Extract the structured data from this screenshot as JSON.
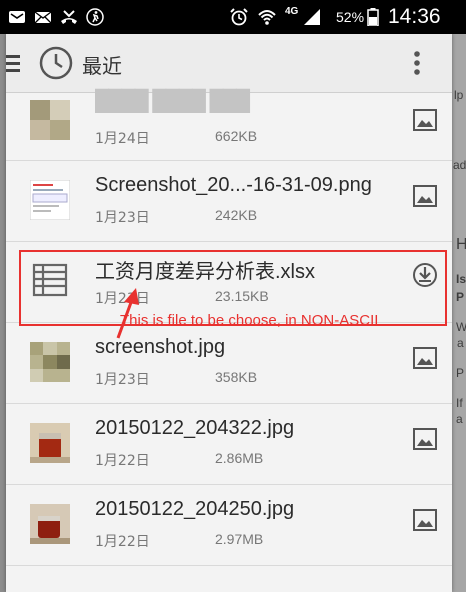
{
  "status_bar": {
    "network": "4G",
    "battery_percent": "52%",
    "time": "14:36"
  },
  "dialog": {
    "title": "最近",
    "icons": {
      "left": "clock-icon",
      "menu": "overflow-menu-icon"
    },
    "files": [
      {
        "name": "",
        "date": "1月24日",
        "size": "662KB",
        "thumb": "blurred-image",
        "action": "image-icon"
      },
      {
        "name": "Screenshot_20...-16-31-09.png",
        "date": "1月23日",
        "size": "242KB",
        "thumb": "screenshot",
        "action": "image-icon"
      },
      {
        "name": "工资月度差异分析表.xlsx",
        "date": "1月23日",
        "size": "23.15KB",
        "thumb": "spreadsheet-icon",
        "action": "download-icon"
      },
      {
        "name": "screenshot.jpg",
        "date": "1月23日",
        "size": "358KB",
        "thumb": "blurred-image",
        "action": "image-icon"
      },
      {
        "name": "20150122_204322.jpg",
        "date": "1月22日",
        "size": "2.86MB",
        "thumb": "photo-tea",
        "action": "image-icon"
      },
      {
        "name": "20150122_204250.jpg",
        "date": "1月22日",
        "size": "2.97MB",
        "thumb": "photo-tea",
        "action": "image-icon"
      }
    ]
  },
  "annotation": {
    "text": "This is file to be choose, in NON-ASCII",
    "color": "#e8312f"
  },
  "background_fragments": [
    "lp",
    "ads",
    "H",
    "Is",
    "P",
    "W",
    "a",
    "P",
    "If",
    "a"
  ]
}
